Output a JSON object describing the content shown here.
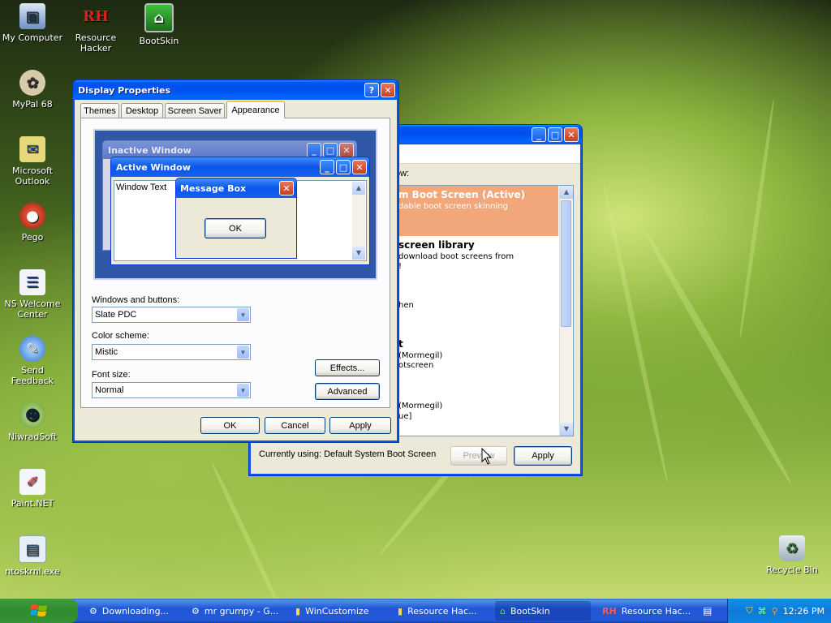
{
  "desktop_icons": [
    {
      "label": "My Computer",
      "icon": "computer-icon"
    },
    {
      "label": "Resource\nHacker",
      "icon": "rh-icon"
    },
    {
      "label": "BootSkin",
      "icon": "bootskin-icon"
    },
    {
      "label": "MyPal 68",
      "icon": "mypal-icon"
    },
    {
      "label": "Microsoft\nOutlook",
      "icon": "outlook-icon"
    },
    {
      "label": "Pego",
      "icon": "pego-icon"
    },
    {
      "label": "NS Welcome\nCenter",
      "icon": "ns-welcome-icon"
    },
    {
      "label": "Send\nFeedback",
      "icon": "feedback-icon"
    },
    {
      "label": "NiwradSoft",
      "icon": "alien-icon"
    },
    {
      "label": "Paint.NET",
      "icon": "paint-icon"
    },
    {
      "label": "ntoskrnl.exe",
      "icon": "exe-icon"
    },
    {
      "label": "Recycle Bin",
      "icon": "recycle-bin-icon"
    }
  ],
  "display_properties": {
    "title": "Display Properties",
    "tabs": [
      "Themes",
      "Desktop",
      "Screen Saver",
      "Appearance"
    ],
    "active_tab": "Appearance",
    "preview": {
      "inactive_title": "Inactive Window",
      "active_title": "Active Window",
      "window_text": "Window Text",
      "msgbox_title": "Message Box",
      "msgbox_ok": "OK"
    },
    "windows_buttons_label": "Windows and buttons:",
    "windows_buttons_value": "Slate PDC",
    "color_scheme_label": "Color scheme:",
    "color_scheme_value": "Mistic",
    "font_size_label": "Font size:",
    "font_size_value": "Normal",
    "effects_button": "Effects...",
    "advanced_button": "Advanced",
    "ok_button": "OK",
    "cancel_button": "Cancel",
    "apply_button": "Apply"
  },
  "bootskin": {
    "list_header": "ow:",
    "items": [
      {
        "title": "m Boot Screen (Active)",
        "line1": "dable boot screen skinning",
        "selected": true
      },
      {
        "title": "screen library",
        "line1": "download boot screens from",
        "line2": "!"
      },
      {
        "title": "",
        "line1": "hen"
      },
      {
        "title": "t",
        "line1": "(Mormegil)",
        "line2": "otscreen"
      },
      {
        "title": "",
        "line1": "(Mormegil)",
        "line2": "ue]"
      }
    ],
    "status": "Currently using: Default System Boot Screen",
    "preview_button": "Preview",
    "apply_button": "Apply"
  },
  "taskbar": {
    "start": "start",
    "items": [
      {
        "label": "Downloading...",
        "icon": "download-icon"
      },
      {
        "label": "mr grumpy - G...",
        "icon": "browser-icon"
      },
      {
        "label": "WinCustomize",
        "icon": "folder-icon"
      },
      {
        "label": "Resource Hac...",
        "icon": "folder-icon"
      },
      {
        "label": "BootSkin",
        "icon": "bootskin-icon"
      },
      {
        "label": "Resource Hac...",
        "icon": "rh-icon"
      }
    ],
    "clock": "12:26 PM"
  },
  "colors": {
    "xp_blue": "#0054e3",
    "selection": "#f2a77a",
    "face": "#ece9d8"
  }
}
